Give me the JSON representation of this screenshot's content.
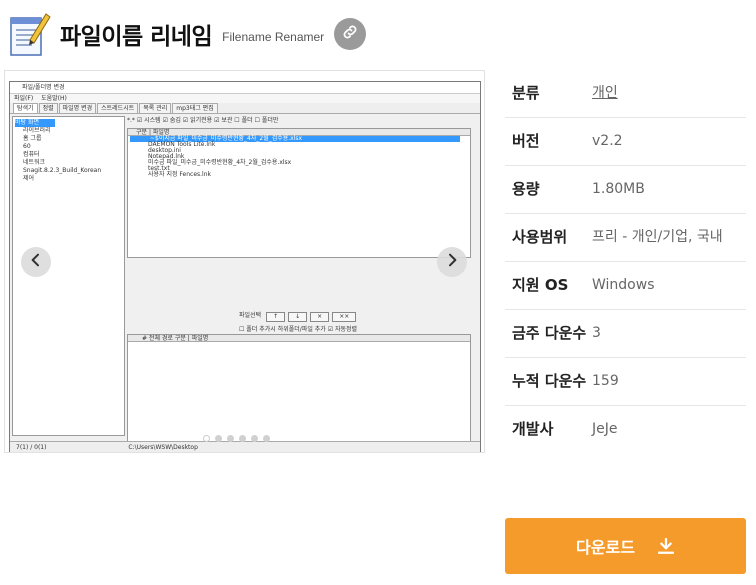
{
  "header": {
    "title": "파일이름 리네임",
    "subtitle": "Filename Renamer"
  },
  "screenshot": {
    "window_title": "파일/폴더명 변경",
    "menu": [
      "파일(F)",
      "도움말(H)"
    ],
    "tabs": [
      "탐색기",
      "정렬",
      "파일명 변경",
      "스트레드시트",
      "목록 관리",
      "mp3태그 편집"
    ],
    "tree": [
      "바탕 화면",
      "라이브러리",
      "홈 그룹",
      "60",
      "컴퓨터",
      "네트워크",
      "Snagit.8.2.3_Build_Korean",
      "제어"
    ],
    "options": "*.*   ☑ 시스템 ☑ 숨김 ☑ 읽기전용 ☑ 보관 ☐ 폴더 ☐ 폴더만",
    "list_header": "구분 | 파일명",
    "list_rows": [
      "~$이지금 파일_미수금_미수령반현황_4차_2월_검수용.xlsx",
      "DAEMON Tools Lite.lnk",
      "desktop.ini",
      "Notepad.lnk",
      "미수금 파일_미수금_미수령반현황_4차_2월_검수용.xlsx",
      "test.txt",
      "사용자 지정 Fences.lnk"
    ],
    "controls": [
      "파일선택",
      "↑",
      "↓",
      "×",
      "××"
    ],
    "controls_opts": "☐ 폴더 추가시 하위폴더/파일 추가   ☑ 자동정렬",
    "list2_header": "#   전체 경로   구분 | 파일명",
    "status_left": "7(1) / 0(1)",
    "status_path": "C:\\Users\\WSW\\Desktop"
  },
  "carousel": {
    "slide_count": 6,
    "active_index": 0
  },
  "info": {
    "rows": [
      {
        "label": "분류",
        "value": "개인"
      },
      {
        "label": "버전",
        "value": "v2.2"
      },
      {
        "label": "용량",
        "value": "1.80MB"
      },
      {
        "label": "사용범위",
        "value": "프리 - 개인/기업, 국내"
      },
      {
        "label": "지원 OS",
        "value": "Windows"
      },
      {
        "label": "금주 다운수",
        "value": "3"
      },
      {
        "label": "누적 다운수",
        "value": "159"
      },
      {
        "label": "개발사",
        "value": "JeJe"
      }
    ]
  },
  "download": {
    "label": "다운로드"
  },
  "colors": {
    "accent": "#f59b2b",
    "link_button": "#9a9a9a",
    "selection": "#3399ff"
  },
  "icons": {
    "app": "notepad-pencil-icon",
    "link": "link-chain-icon",
    "prev": "chevron-left-icon",
    "next": "chevron-right-icon",
    "download": "download-icon"
  }
}
